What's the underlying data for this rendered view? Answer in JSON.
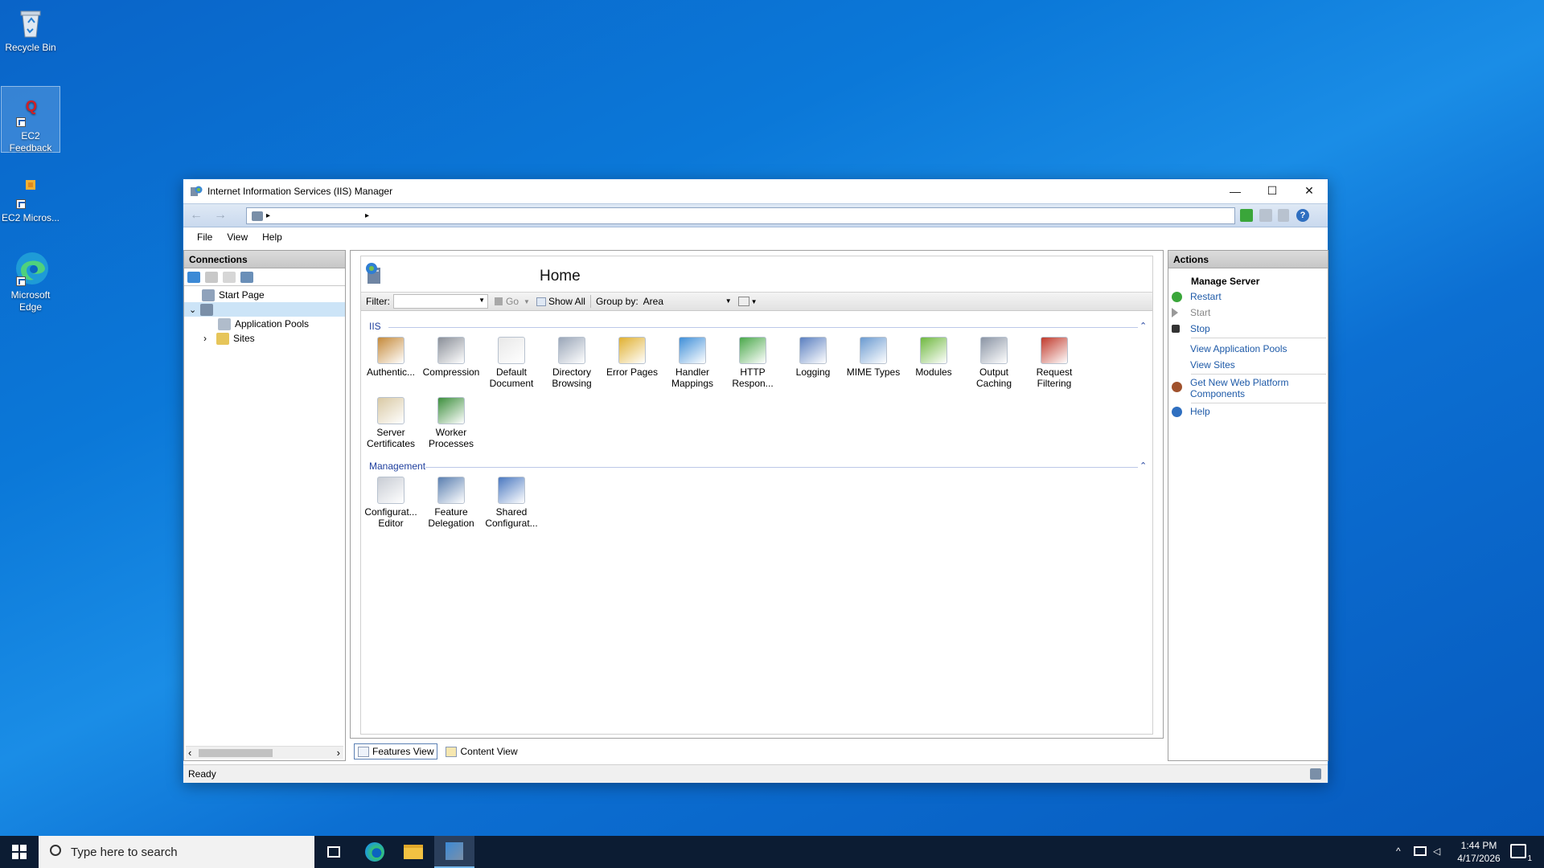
{
  "desktop": {
    "icons": [
      {
        "label": "Recycle Bin"
      },
      {
        "label": "EC2 Feedback"
      },
      {
        "label": "EC2 Micros..."
      },
      {
        "label": "Microsoft Edge"
      }
    ]
  },
  "window": {
    "title": "Internet Information Services (IIS) Manager",
    "controls": {
      "minimize": "—",
      "maximize": "☐",
      "close": "✕"
    },
    "address": {
      "back": "←",
      "forward": "→",
      "separator1": "▸",
      "separator2": "▸"
    },
    "menu": [
      "File",
      "View",
      "Help"
    ]
  },
  "connections": {
    "header": "Connections",
    "tree": {
      "start_page": "Start Page",
      "app_pools": "Application Pools",
      "sites": "Sites",
      "expand_open": "⌄",
      "expand_closed": "›"
    },
    "scroll_left": "‹",
    "scroll_right": "›"
  },
  "home": {
    "title": "Home",
    "filter_label": "Filter:",
    "go_label": "Go",
    "show_all_label": "Show All",
    "group_by_label": "Group by:",
    "group_by_value": "Area",
    "groups": [
      {
        "name": "IIS",
        "features": [
          {
            "label": "Authentic...",
            "icon": "authentication-icon",
            "color": "#c58a3a"
          },
          {
            "label": "Compression",
            "icon": "compression-icon",
            "color": "#8a8f98"
          },
          {
            "label": "Default\nDocument",
            "icon": "default-document-icon",
            "color": "#e8e8e8"
          },
          {
            "label": "Directory\nBrowsing",
            "icon": "directory-browsing-icon",
            "color": "#9aa6b8"
          },
          {
            "label": "Error Pages",
            "icon": "error-pages-icon",
            "color": "#e0b030"
          },
          {
            "label": "Handler\nMappings",
            "icon": "handler-mappings-icon",
            "color": "#3f8fd8"
          },
          {
            "label": "HTTP\nRespon...",
            "icon": "http-response-headers-icon",
            "color": "#4aa84a"
          },
          {
            "label": "Logging",
            "icon": "logging-icon",
            "color": "#5a7fc0"
          },
          {
            "label": "MIME Types",
            "icon": "mime-types-icon",
            "color": "#6a9ad0"
          },
          {
            "label": "Modules",
            "icon": "modules-icon",
            "color": "#6fb83f"
          },
          {
            "label": "Output\nCaching",
            "icon": "output-caching-icon",
            "color": "#8a94a4"
          },
          {
            "label": "Request\nFiltering",
            "icon": "request-filtering-icon",
            "color": "#c0392b"
          },
          {
            "label": "Server\nCertificates",
            "icon": "server-certificates-icon",
            "color": "#d9c9a4"
          },
          {
            "label": "Worker\nProcesses",
            "icon": "worker-processes-icon",
            "color": "#3d8f3d"
          }
        ]
      },
      {
        "name": "Management",
        "features": [
          {
            "label": "Configurat...\nEditor",
            "icon": "configuration-editor-icon",
            "color": "#c8ccd4"
          },
          {
            "label": "Feature\nDelegation",
            "icon": "feature-delegation-icon",
            "color": "#5a7fb0"
          },
          {
            "label": "Shared\nConfigurat...",
            "icon": "shared-configuration-icon",
            "color": "#4a78c0"
          }
        ]
      }
    ],
    "collapse_glyph": "⌃"
  },
  "view_tabs": {
    "features": "Features View",
    "content": "Content View"
  },
  "actions": {
    "header": "Actions",
    "section": "Manage Server",
    "items": {
      "restart": "Restart",
      "start": "Start",
      "stop": "Stop",
      "view_pools": "View Application Pools",
      "view_sites": "View Sites",
      "get_new": "Get New Web Platform Components",
      "help": "Help"
    }
  },
  "status": {
    "text": "Ready"
  },
  "taskbar": {
    "search_placeholder": "Type here to search",
    "time": "1:44 PM",
    "date": "4/17/2026",
    "notif_count": "1"
  }
}
